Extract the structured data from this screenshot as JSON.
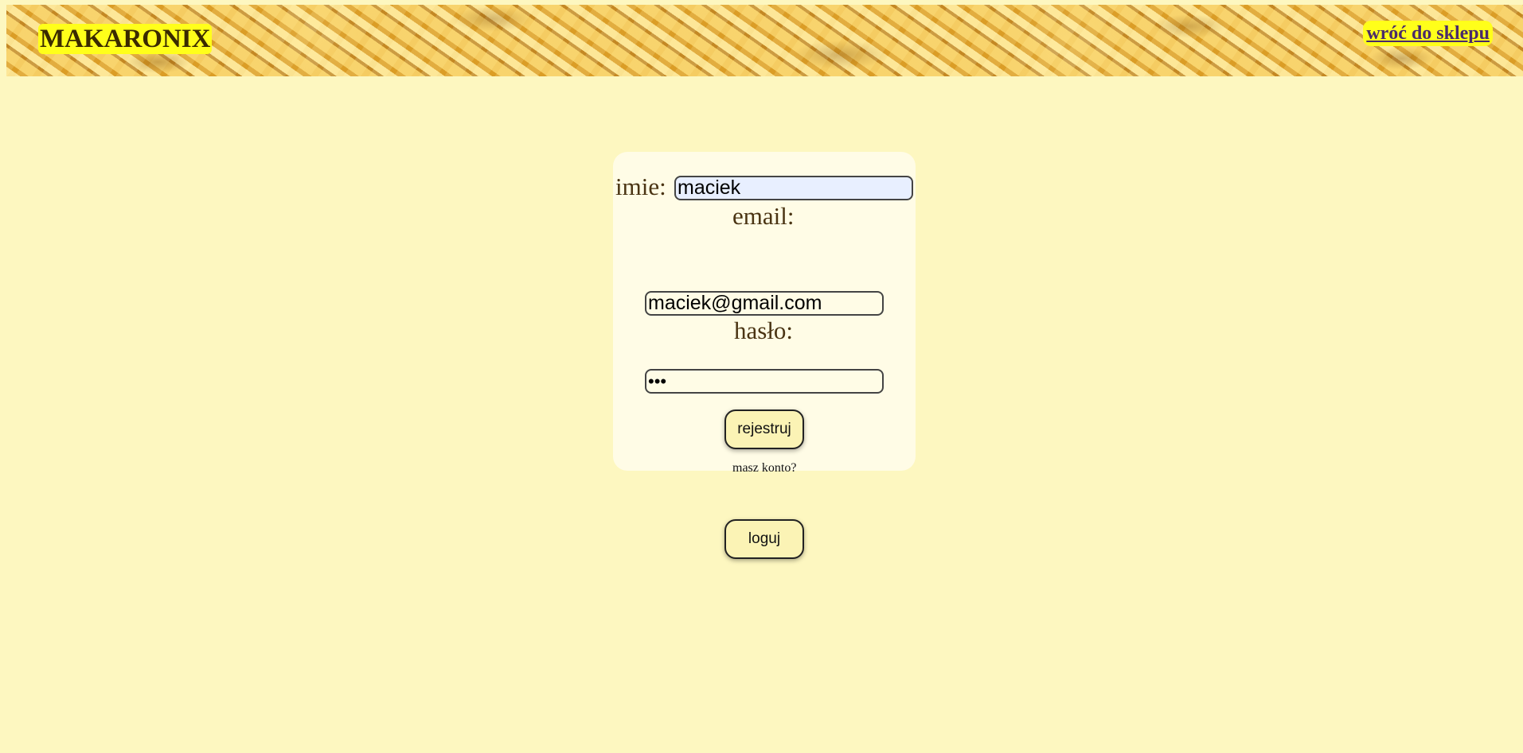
{
  "header": {
    "brand": "MAKARONIX",
    "back_link": "wróć do sklepu"
  },
  "form": {
    "name_label": "imie:",
    "name_value": "maciek",
    "email_label": "email:",
    "email_value": "maciek@gmail.com",
    "password_label": "hasło:",
    "password_value": "•••",
    "register_button": "rejestruj",
    "have_account_text": "masz konto?",
    "login_button": "loguj"
  }
}
